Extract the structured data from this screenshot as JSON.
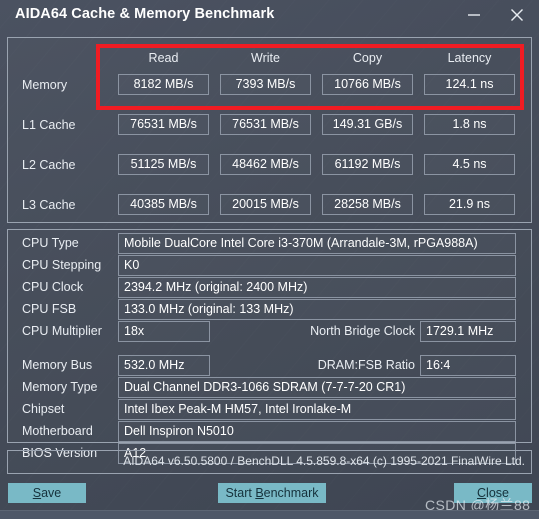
{
  "window": {
    "title": "AIDA64 Cache & Memory Benchmark",
    "minimize_icon": "minimize-icon",
    "close_icon": "close-icon"
  },
  "benchmark": {
    "columns": [
      "Read",
      "Write",
      "Copy",
      "Latency"
    ],
    "rows": [
      {
        "label": "Memory",
        "values": [
          "8182 MB/s",
          "7393 MB/s",
          "10766 MB/s",
          "124.1 ns"
        ]
      },
      {
        "label": "L1 Cache",
        "values": [
          "76531 MB/s",
          "76531 MB/s",
          "149.31 GB/s",
          "1.8 ns"
        ]
      },
      {
        "label": "L2 Cache",
        "values": [
          "51125 MB/s",
          "48462 MB/s",
          "61192 MB/s",
          "4.5 ns"
        ]
      },
      {
        "label": "L3 Cache",
        "values": [
          "40385 MB/s",
          "20015 MB/s",
          "28258 MB/s",
          "21.9 ns"
        ]
      }
    ],
    "highlight_color": "#f01c23"
  },
  "info": {
    "cpu_type_label": "CPU Type",
    "cpu_type_value": "Mobile DualCore Intel Core i3-370M  (Arrandale-3M, rPGA988A)",
    "cpu_stepping_label": "CPU Stepping",
    "cpu_stepping_value": "K0",
    "cpu_clock_label": "CPU Clock",
    "cpu_clock_value": "2394.2 MHz  (original: 2400 MHz)",
    "cpu_fsb_label": "CPU FSB",
    "cpu_fsb_value": "133.0 MHz  (original: 133 MHz)",
    "cpu_multiplier_label": "CPU Multiplier",
    "cpu_multiplier_value": "18x",
    "north_bridge_clock_label": "North Bridge Clock",
    "north_bridge_clock_value": "1729.1 MHz",
    "memory_bus_label": "Memory Bus",
    "memory_bus_value": "532.0 MHz",
    "dram_fsb_ratio_label": "DRAM:FSB Ratio",
    "dram_fsb_ratio_value": "16:4",
    "memory_type_label": "Memory Type",
    "memory_type_value": "Dual Channel DDR3-1066 SDRAM  (7-7-7-20 CR1)",
    "chipset_label": "Chipset",
    "chipset_value": "Intel Ibex Peak-M HM57, Intel Ironlake-M",
    "motherboard_label": "Motherboard",
    "motherboard_value": "Dell Inspiron N5010",
    "bios_version_label": "BIOS Version",
    "bios_version_value": "A12"
  },
  "footer": {
    "version_text": "AIDA64 v6.50.5800 / BenchDLL 4.5.859.8-x64  (c) 1995-2021 FinalWire Ltd.",
    "save_prefix": "",
    "save_accel": "S",
    "save_suffix": "ave",
    "benchmark_prefix": "Start ",
    "benchmark_accel": "B",
    "benchmark_suffix": "enchmark",
    "close_prefix": "",
    "close_accel": "C",
    "close_suffix": "lose",
    "button_color": "#79b9c6"
  },
  "watermark": {
    "text": "CSDN @杨兰88"
  }
}
